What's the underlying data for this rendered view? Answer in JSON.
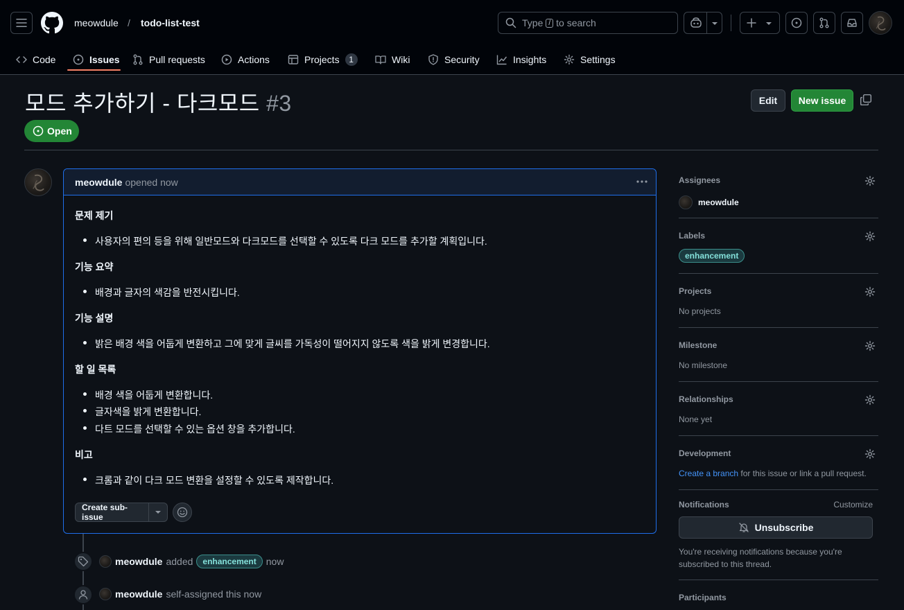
{
  "header": {
    "owner": "meowdule",
    "separator": "/",
    "repo": "todo-list-test",
    "search_prefix": "Type",
    "search_key": "/",
    "search_suffix": "to search"
  },
  "tabs": [
    {
      "label": "Code",
      "icon": "code-icon"
    },
    {
      "label": "Issues",
      "icon": "issue-opened-icon"
    },
    {
      "label": "Pull requests",
      "icon": "git-pull-request-icon"
    },
    {
      "label": "Actions",
      "icon": "play-icon"
    },
    {
      "label": "Projects",
      "icon": "table-icon",
      "count": "1"
    },
    {
      "label": "Wiki",
      "icon": "book-icon"
    },
    {
      "label": "Security",
      "icon": "shield-icon"
    },
    {
      "label": "Insights",
      "icon": "graph-icon"
    },
    {
      "label": "Settings",
      "icon": "gear-icon"
    }
  ],
  "issue": {
    "title": "모드 추가하기 - 다크모드",
    "number": "#3",
    "state": "Open",
    "edit_label": "Edit",
    "new_issue_label": "New issue"
  },
  "comment": {
    "author": "meowdule",
    "meta": "opened now",
    "sections": [
      {
        "heading": "문제 제기",
        "items": [
          "사용자의 편의 등을 위해 일반모드와 다크모드를 선택할 수 있도록 다크 모드를 추가할 계획입니다."
        ]
      },
      {
        "heading": "기능 요약",
        "items": [
          "배경과 글자의 색감을 반전시킵니다."
        ]
      },
      {
        "heading": "기능 설명",
        "items": [
          "밝은 배경 색을 어둡게 변환하고 그에 맞게 글씨를 가독성이 떨어지지 않도록 색을 밝게 변경합니다."
        ]
      },
      {
        "heading": "할 일 목록",
        "items": [
          "배경 색을 어둡게 변환합니다.",
          "글자색을 밝게 변환합니다.",
          "다트 모드를 선택할 수 있는 옵션 창을 추가합니다."
        ]
      },
      {
        "heading": "비고",
        "items": [
          "크롬과 같이 다크 모드 변환을 설정할 수 있도록 제작합니다."
        ]
      }
    ],
    "create_sub_issue": "Create sub-issue"
  },
  "timeline": [
    {
      "user": "meowdule",
      "action": "added",
      "label": "enhancement",
      "time": "now"
    },
    {
      "user": "meowdule",
      "action": "self-assigned this now"
    }
  ],
  "sidebar": {
    "assignees_title": "Assignees",
    "assignee": "meowdule",
    "labels_title": "Labels",
    "label": "enhancement",
    "projects_title": "Projects",
    "projects_value": "No projects",
    "milestone_title": "Milestone",
    "milestone_value": "No milestone",
    "relationships_title": "Relationships",
    "relationships_value": "None yet",
    "development_title": "Development",
    "development_link": "Create a branch",
    "development_rest": "for this issue or link a pull request.",
    "notifications_title": "Notifications",
    "customize": "Customize",
    "unsubscribe": "Unsubscribe",
    "notif_reason": "You're receiving notifications because you're subscribed to this thread.",
    "participants_title": "Participants"
  },
  "colors": {
    "accent_open": "#238636",
    "link": "#4493f8",
    "tab_underline": "#f78166",
    "label_bg": "#1b3a3f"
  }
}
